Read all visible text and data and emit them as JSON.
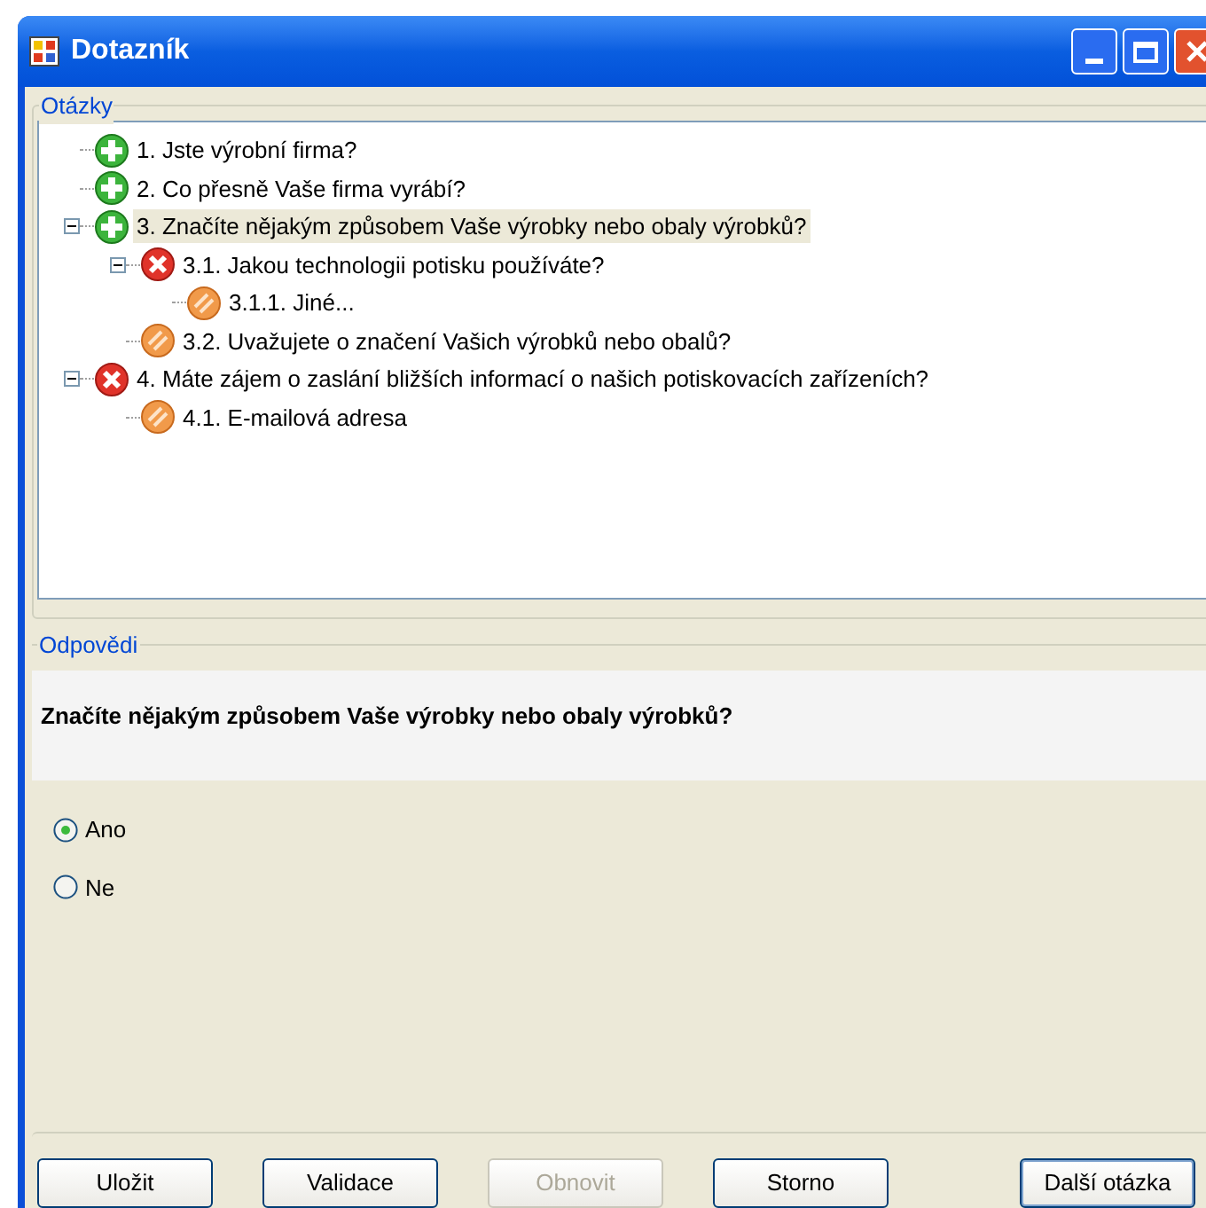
{
  "window": {
    "title": "Dotazník"
  },
  "questions_group": {
    "label": "Otázky",
    "tree": [
      {
        "label": "1. Jste výrobní firma?",
        "kind": "answered",
        "selected": false
      },
      {
        "label": "2. Co přesně Vaše firma vyrábí?",
        "kind": "answered",
        "selected": false
      },
      {
        "label": "3. Značíte nějakým způsobem Vaše výrobky nebo obaly výrobků?",
        "kind": "answered",
        "selected": true,
        "expanded": true,
        "children": [
          {
            "label": "3.1. Jakou technologii potisku používáte?",
            "kind": "invalid",
            "selected": false,
            "expanded": true,
            "children": [
              {
                "label": "3.1.1. Jiné...",
                "kind": "skipped",
                "selected": false
              }
            ]
          },
          {
            "label": "3.2. Uvažujete o značení Vašich výrobků nebo obalů?",
            "kind": "skipped",
            "selected": false
          }
        ]
      },
      {
        "label": "4. Máte zájem o zaslání bližších informací o našich potiskovacích zařízeních?",
        "kind": "invalid",
        "selected": false,
        "expanded": true,
        "children": [
          {
            "label": "4.1. E-mailová adresa",
            "kind": "skipped",
            "selected": false
          }
        ]
      }
    ]
  },
  "answers_group": {
    "label": "Odpovědi",
    "question": "Značíte nějakým způsobem Vaše výrobky nebo obaly výrobků?",
    "options": [
      {
        "label": "Ano",
        "selected": true
      },
      {
        "label": "Ne",
        "selected": false
      }
    ]
  },
  "buttons": [
    {
      "label": "Uložit",
      "disabled": false,
      "default": false
    },
    {
      "label": "Validace",
      "disabled": false,
      "default": false
    },
    {
      "label": "Obnovit",
      "disabled": true,
      "default": false
    },
    {
      "label": "Storno",
      "disabled": false,
      "default": false
    },
    {
      "label": "Další otázka",
      "disabled": false,
      "default": true
    }
  ]
}
